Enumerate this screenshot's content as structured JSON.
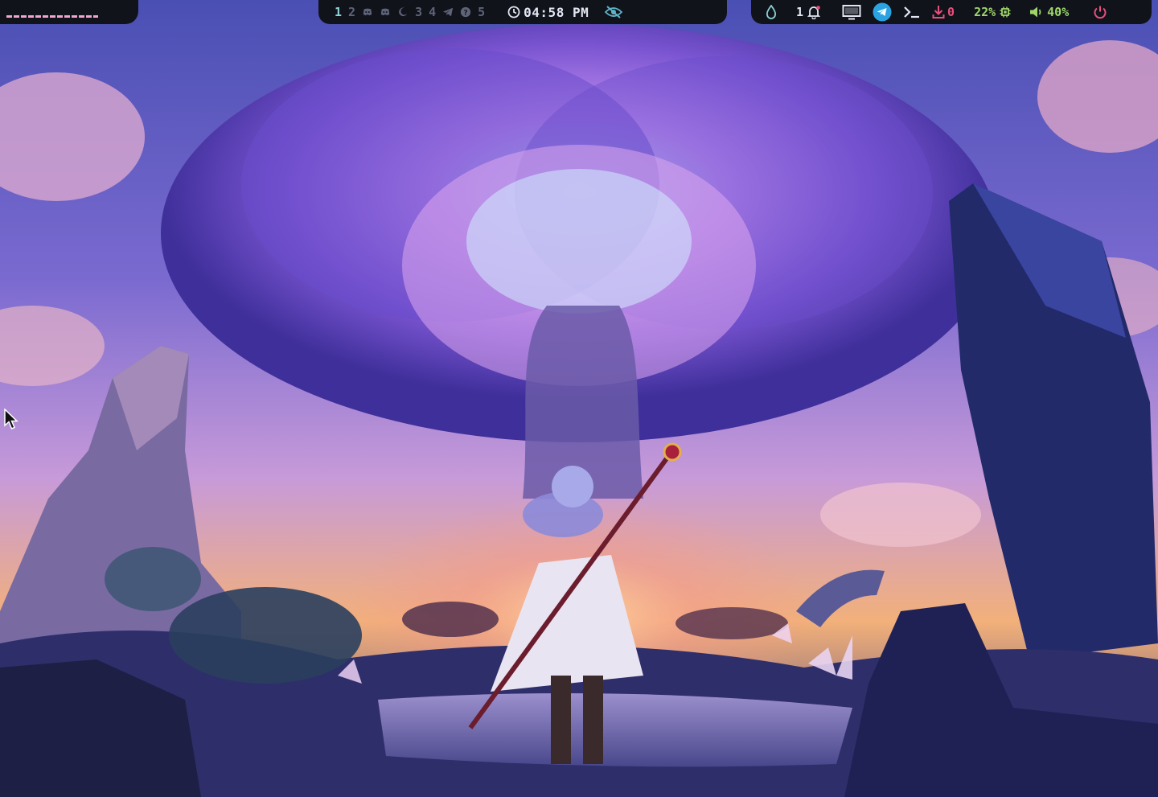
{
  "workspaces": {
    "active": "1",
    "labels": [
      "1",
      "2",
      "3",
      "4",
      "5"
    ],
    "icons": [
      "discord-icon",
      "discord-icon",
      "moon-icon",
      "telegram-icon",
      "help-circle-icon"
    ]
  },
  "clock": {
    "time": "04:58 PM",
    "icon": "clock-icon"
  },
  "status": {
    "eye_icon": "eye-off-icon",
    "droplet_icon": "droplet-icon",
    "notifications": "1",
    "notification_icon": "bell-icon",
    "screen_icon": "monitor-icon",
    "telegram_icon": "telegram-icon",
    "terminal_icon": "terminal-icon",
    "downloads": "0",
    "download_icon": "download-icon",
    "cpu": "22%",
    "cpu_icon": "chip-icon",
    "volume": "40%",
    "volume_icon": "speaker-icon",
    "power_icon": "power-icon"
  },
  "colors": {
    "bar_bg": "#11131b",
    "active_workspace": "#8fd3d6",
    "inactive_workspace": "#5e6378",
    "accent_green": "#9ed66a",
    "accent_red": "#e6507a",
    "telegram_blue": "#2aa3e0",
    "dash_pink": "#f0a6ce"
  }
}
